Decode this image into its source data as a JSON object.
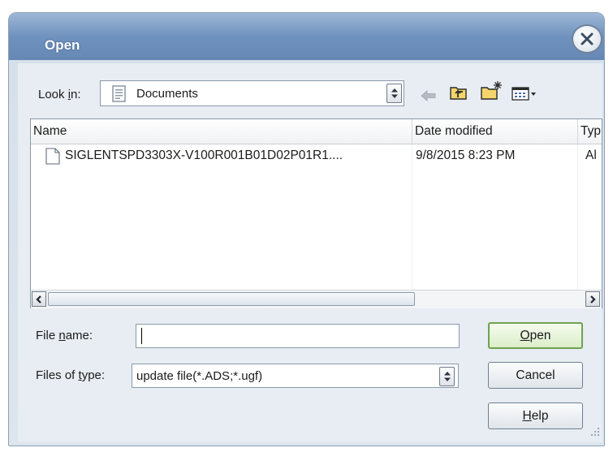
{
  "window": {
    "title": "Open",
    "close_label": "close"
  },
  "lookin": {
    "label_pre": "Look ",
    "label_accel": "i",
    "label_post": "n:",
    "value": "Documents"
  },
  "toolbar": {
    "icons": [
      "back-arrow-icon",
      "up-one-level-icon",
      "create-new-folder-icon",
      "view-menu-icon"
    ]
  },
  "filelist": {
    "columns": [
      "Name",
      "Date modified",
      "Typ"
    ],
    "rows": [
      {
        "name": "SIGLENTSPD3303X-V100R001B01D02P01R1....",
        "date": "9/8/2015 8:23 PM",
        "type": "Al"
      }
    ]
  },
  "filename": {
    "label_pre": "File ",
    "label_accel": "n",
    "label_post": "ame:",
    "value": ""
  },
  "filetype": {
    "label_pre": "Files of ",
    "label_accel": "t",
    "label_post": "ype:",
    "value": "update file(*.ADS;*.ugf)"
  },
  "buttons": {
    "open_accel": "O",
    "open_rest": "pen",
    "cancel": "Cancel",
    "help_accel": "H",
    "help_rest": "elp"
  },
  "colors": {
    "title_bar": "#6f91bd",
    "dialog_bg": "#e8edf3",
    "default_button_border": "#6ea34d"
  }
}
